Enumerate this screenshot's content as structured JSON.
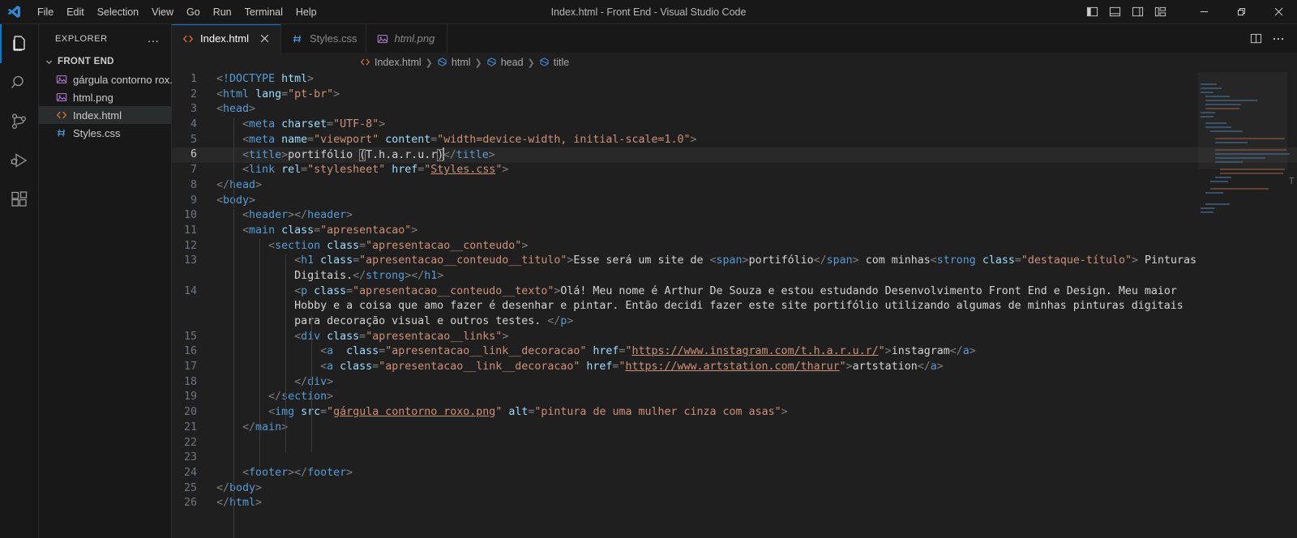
{
  "window": {
    "title": "Index.html - Front End - Visual Studio Code",
    "menus": [
      "File",
      "Edit",
      "Selection",
      "View",
      "Go",
      "Run",
      "Terminal",
      "Help"
    ],
    "layout_buttons": [
      {
        "name": "toggle-primary-sidebar",
        "label": "Toggle Primary Side Bar"
      },
      {
        "name": "toggle-panel",
        "label": "Toggle Panel"
      },
      {
        "name": "toggle-secondary-sidebar",
        "label": "Toggle Secondary Side Bar"
      },
      {
        "name": "customize-layout",
        "label": "Customize Layout"
      }
    ],
    "window_buttons": [
      {
        "name": "minimize",
        "label": "Minimize"
      },
      {
        "name": "restore",
        "label": "Restore"
      },
      {
        "name": "close",
        "label": "Close"
      }
    ]
  },
  "activitybar": {
    "items": [
      {
        "name": "explorer",
        "label": "Explorer",
        "active": true
      },
      {
        "name": "search",
        "label": "Search",
        "active": false
      },
      {
        "name": "source-control",
        "label": "Source Control",
        "active": false
      },
      {
        "name": "run-and-debug",
        "label": "Run and Debug",
        "active": false
      },
      {
        "name": "extensions",
        "label": "Extensions",
        "active": false
      }
    ]
  },
  "sidebar": {
    "title": "EXPLORER",
    "more_actions": "…",
    "folder": "FRONT END",
    "files": [
      {
        "name": "gárgula contorno rox...",
        "icon": "image-icon",
        "selected": false
      },
      {
        "name": "html.png",
        "icon": "image-icon",
        "selected": false
      },
      {
        "name": "Index.html",
        "icon": "html-icon",
        "selected": true
      },
      {
        "name": "Styles.css",
        "icon": "css-icon",
        "selected": false
      }
    ]
  },
  "tabs": [
    {
      "label": "Index.html",
      "icon": "html-icon",
      "active": true,
      "italic": false,
      "closable": true
    },
    {
      "label": "Styles.css",
      "icon": "css-icon",
      "active": false,
      "italic": false,
      "closable": false
    },
    {
      "label": "html.png",
      "icon": "image-icon",
      "active": false,
      "italic": true,
      "closable": false
    }
  ],
  "editor_actions": [
    {
      "name": "split-editor-right",
      "label": "Split Editor Right"
    },
    {
      "name": "more-actions",
      "label": "More Actions..."
    }
  ],
  "breadcrumb": [
    {
      "label": "Index.html",
      "icon": "html-icon"
    },
    {
      "label": "html",
      "icon": "symbol-field-icon"
    },
    {
      "label": "head",
      "icon": "symbol-field-icon"
    },
    {
      "label": "title",
      "icon": "symbol-field-icon"
    }
  ],
  "editor": {
    "active_line": 6,
    "line_numbers": [
      1,
      2,
      3,
      4,
      5,
      6,
      7,
      8,
      9,
      10,
      11,
      12,
      13,
      14,
      15,
      16,
      17,
      18,
      19,
      20,
      21,
      22,
      23,
      24,
      25,
      26
    ],
    "code_lines": [
      "<!DOCTYPE html>",
      "<html lang=\"pt-br\">",
      "<head>",
      "    <meta charset=\"UTF-8\">",
      "    <meta name=\"viewport\" content=\"width=device-width, initial-scale=1.0\">",
      "    <title>portifólio (T.h.a.r.u.r)</title>",
      "    <link rel=\"stylesheet\" href=\"Styles.css\">",
      "</head>",
      "<body>",
      "    <header></header>",
      "    <main class=\"apresentacao\">",
      "        <section class=\"apresentacao__conteudo\">",
      "            <h1 class=\"apresentacao__conteudo__titulo\">Esse será um site de <span>portifólio</span> com minhas<strong class=\"destaque-título\"> Pinturas Digitais.</strong></h1>",
      "            <p class=\"apresentacao__conteudo__texto\">Olá! Meu nome é Arthur De Souza e estou estudando Desenvolvimento Front End e Design. Meu maior Hobby e a coisa que amo fazer é desenhar e pintar. Então decidi fazer este site portifólio utilizando algumas de minhas pinturas digitais para decoração visual e outros testes. </p>",
      "            <div class=\"apresentacao__links\">",
      "                <a  class=\"apresentacao__link__decoracao\" href=\"https://www.instagram.com/t.h.a.r.u.r/\">instagram</a>",
      "                <a class=\"apresentacao__link__decoracao\" href=\"https://www.artstation.com/tharur\">artstation</a>",
      "            </div>",
      "        </section>",
      "        <img src=\"gárgula contorno roxo.png\" alt=\"pintura de uma mulher cinza com asas\">",
      "    </main>",
      "",
      "",
      "    <footer></footer>",
      "</body>",
      "</html>"
    ]
  },
  "colors": {
    "accent": "#0078d4",
    "tag": "#569cd6",
    "attribute": "#9cdcfe",
    "string": "#ce9178",
    "text": "#d4d4d4",
    "editor_bg": "#1f1f1f",
    "chrome_bg": "#181818"
  }
}
